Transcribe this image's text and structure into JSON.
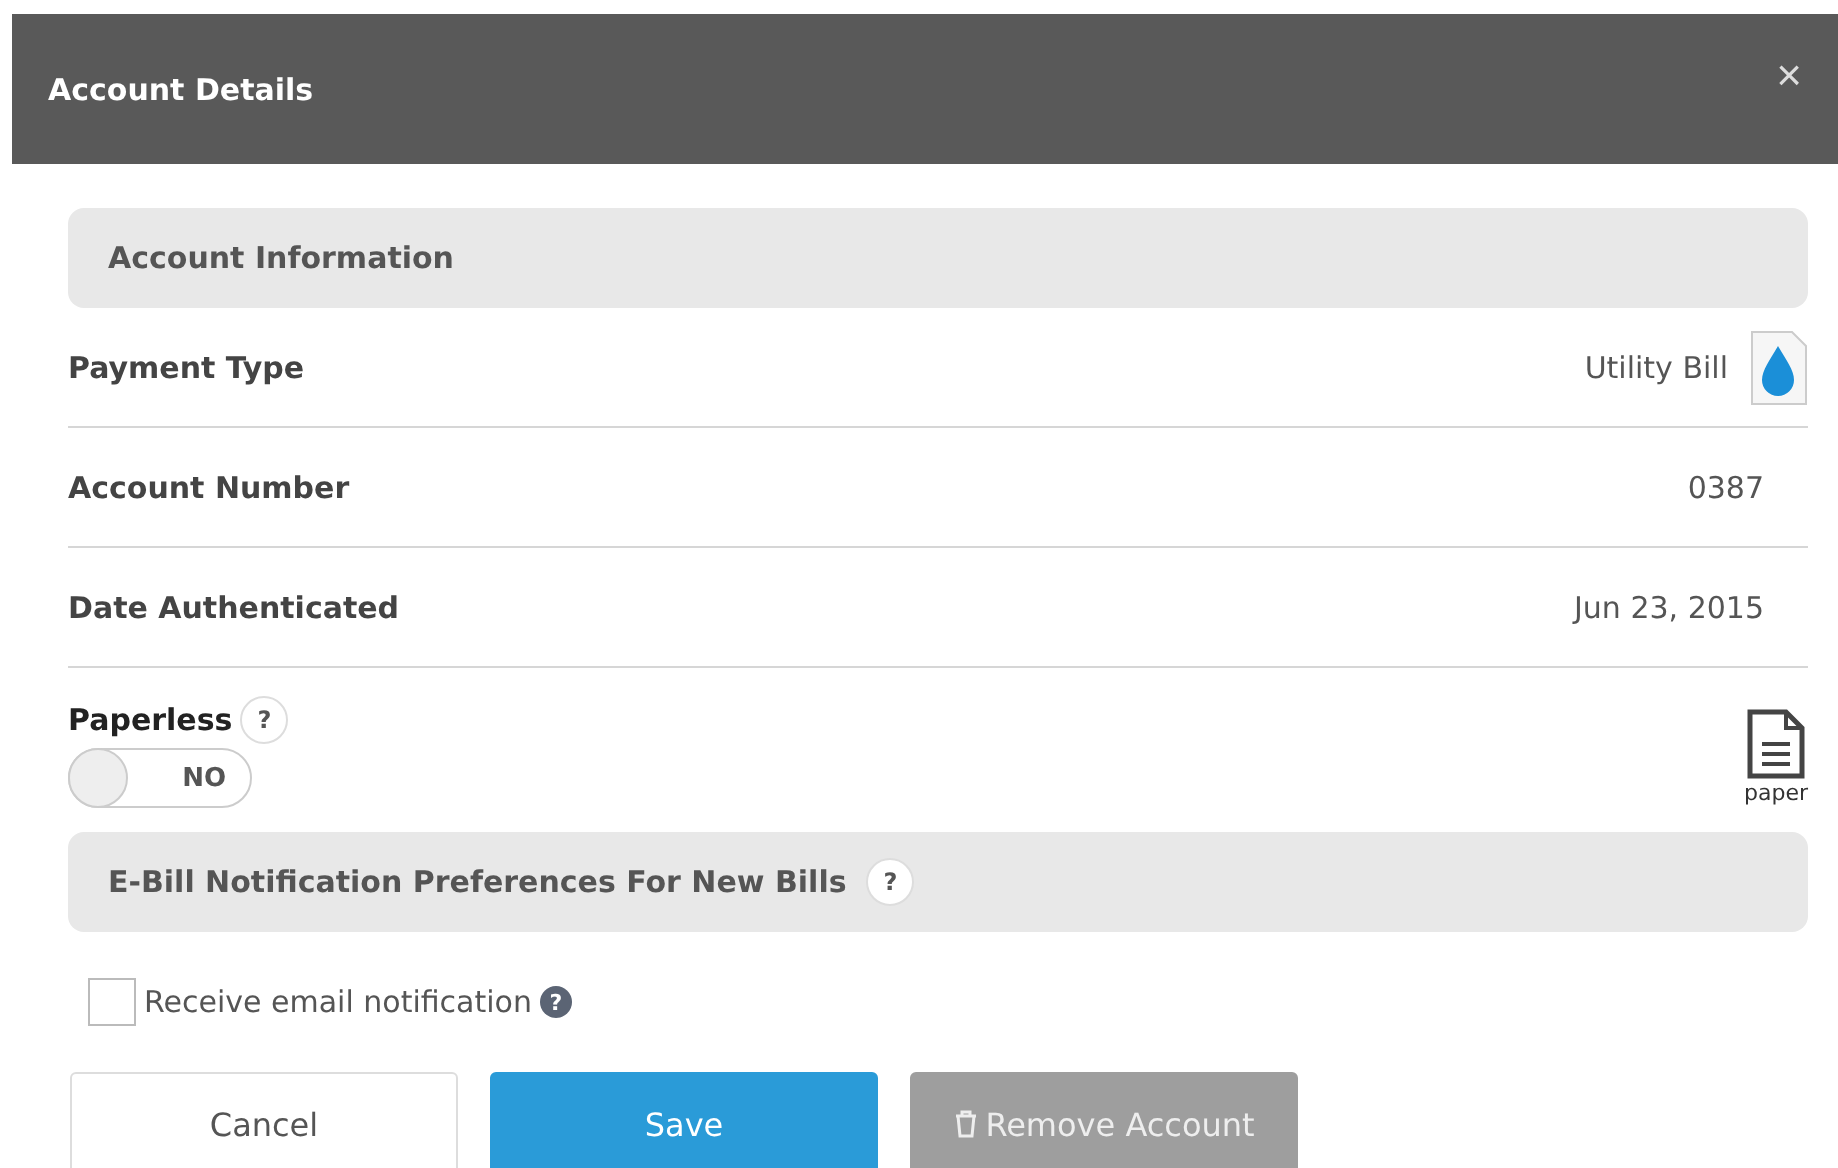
{
  "window": {
    "title": "Account Details",
    "close": "×"
  },
  "account_information": {
    "title": "Account Information",
    "rows": [
      {
        "kind": "icon",
        "label": "Payment Type",
        "value": "Utility Bill"
      },
      {
        "kind": "plain",
        "label": "Account Number",
        "value": "0387"
      },
      {
        "kind": "plain",
        "label": "Date Authenticated",
        "value": "Jun 23, 2015"
      }
    ]
  },
  "paperless": {
    "label": "Paperless",
    "help": "?",
    "on": false,
    "toggle_text": "NO",
    "paper_label": "paper"
  },
  "notifications": {
    "title": "E-Bill Notification Preferences For New Bills",
    "help": "?",
    "options": [
      {
        "label": "Receive email notification",
        "help": "?",
        "checked": false
      }
    ]
  },
  "buttons": [
    {
      "kind": "secondary",
      "label": "Cancel",
      "disabled": false
    },
    {
      "kind": "primary",
      "label": "Save",
      "disabled": false
    },
    {
      "kind": "danger",
      "label": "Remove Account",
      "disabled": true
    }
  ]
}
